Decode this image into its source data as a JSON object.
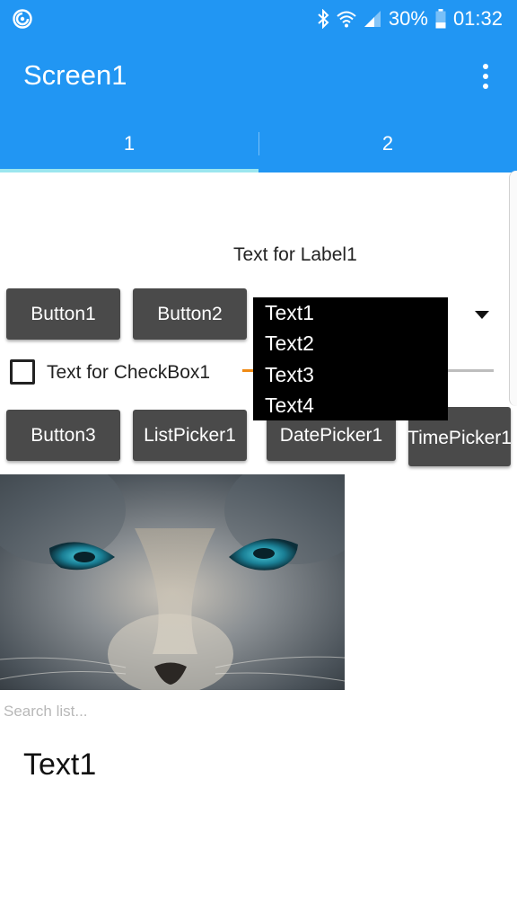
{
  "status_bar": {
    "battery_percent": "30%",
    "time": "01:32",
    "icons": [
      "app-notification-icon",
      "bluetooth-icon",
      "wifi-icon",
      "signal-icon",
      "battery-icon"
    ]
  },
  "app_bar": {
    "title": "Screen1",
    "overflow_icon": "more-vert-icon"
  },
  "tabs": [
    {
      "label": "1",
      "active": true
    },
    {
      "label": "2",
      "active": false
    }
  ],
  "label1": "Text for Label1",
  "buttons": {
    "button1": "Button1",
    "button2": "Button2",
    "button3": "Button3",
    "listpicker1": "ListPicker1",
    "datepicker1": "DatePicker1",
    "timepicker1": "TimePicker1"
  },
  "spinner": {
    "options": [
      "Text1",
      "Text2",
      "Text3",
      "Text4"
    ]
  },
  "checkbox1": {
    "label": "Text for CheckBox1",
    "checked": false
  },
  "slider": {
    "accent_color": "#ef8a14"
  },
  "search": {
    "placeholder": "Search list..."
  },
  "list_items": [
    "Text1"
  ],
  "colors": {
    "primary": "#2196f3",
    "tab_indicator": "#9ce6ef",
    "button": "#4a4a4a"
  }
}
